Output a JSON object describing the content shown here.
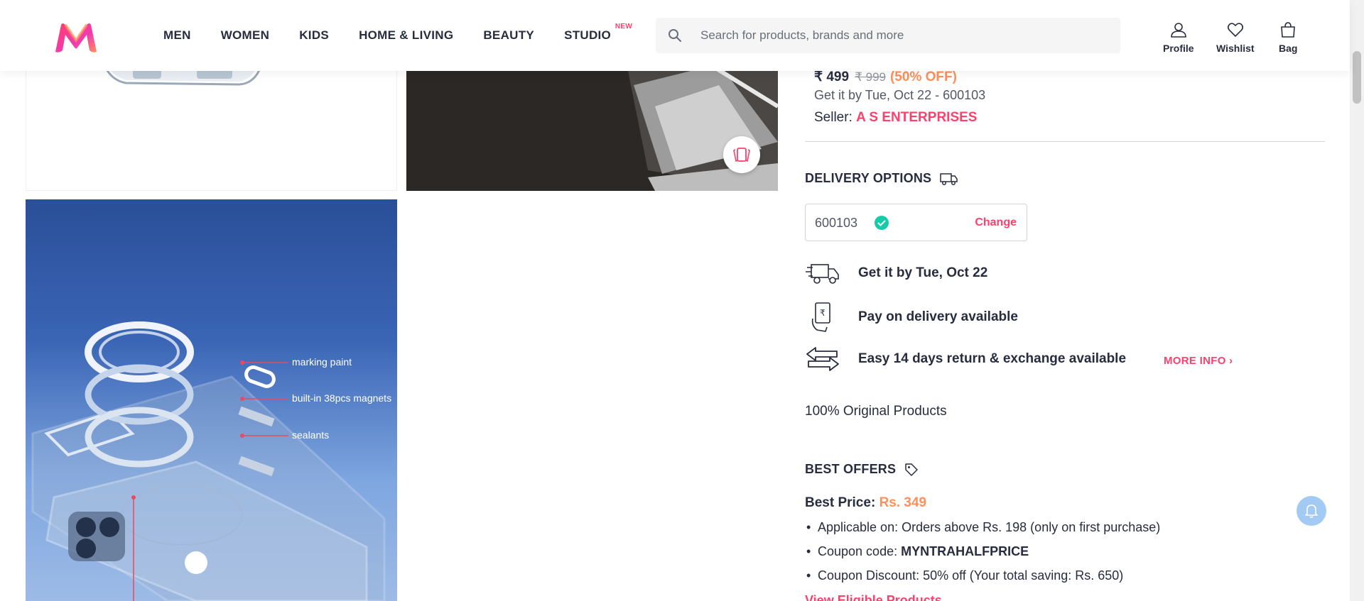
{
  "header": {
    "nav": [
      {
        "label": "MEN"
      },
      {
        "label": "WOMEN"
      },
      {
        "label": "KIDS"
      },
      {
        "label": "HOME & LIVING"
      },
      {
        "label": "BEAUTY"
      },
      {
        "label": "STUDIO",
        "badge": "NEW"
      }
    ],
    "search_placeholder": "Search for products, brands and more",
    "actions": [
      {
        "label": "Profile",
        "icon": "user-icon"
      },
      {
        "label": "Wishlist",
        "icon": "heart-icon"
      },
      {
        "label": "Bag",
        "icon": "bag-icon"
      }
    ]
  },
  "product": {
    "price": "₹ 499",
    "mrp": "₹ 999",
    "discount": "(50% OFF)",
    "eta": "Get it by Tue, Oct 22 - 600103",
    "seller_label": "Seller:",
    "seller_name": "A S ENTERPRISES"
  },
  "images": {
    "annotations": [
      "marking paint",
      "built-in 38pcs magnets",
      "sealants"
    ]
  },
  "delivery": {
    "title": "DELIVERY OPTIONS",
    "pincode": "600103",
    "change_label": "Change",
    "options": [
      {
        "text": "Get it by Tue, Oct 22",
        "icon": "truck-icon"
      },
      {
        "text": "Pay on delivery available",
        "icon": "cash-hand-icon"
      },
      {
        "text": "Easy 14 days return & exchange available",
        "icon": "exchange-arrows-icon"
      }
    ],
    "more_info": "MORE INFO",
    "original": "100% Original Products"
  },
  "offers": {
    "title": "BEST OFFERS",
    "best_price_label": "Best Price:",
    "best_price_value": "Rs. 349",
    "items": [
      {
        "prefix": "Applicable on: ",
        "value": "Orders above Rs. 198 (only on first purchase)",
        "bold": false
      },
      {
        "prefix": "Coupon code: ",
        "value": "MYNTRAHALFPRICE",
        "bold": true
      },
      {
        "prefix": "Coupon Discount: ",
        "value": "50% off (Your total saving: Rs. 650)",
        "bold": false
      }
    ],
    "view_link": "View Eligible Products"
  },
  "colors": {
    "brand_pink": "#ff3f6c",
    "discount_orange": "#ff905a",
    "text_dark": "#282c3f"
  }
}
